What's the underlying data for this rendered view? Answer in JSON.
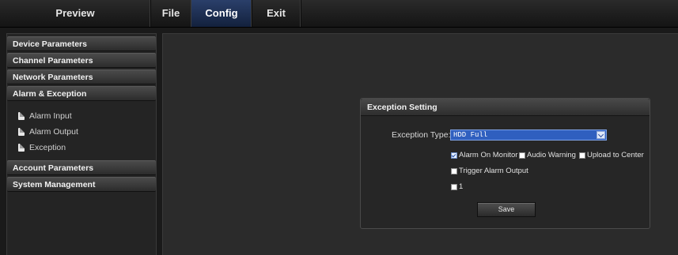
{
  "nav": {
    "preview": "Preview",
    "file": "File",
    "config": "Config",
    "exit": "Exit"
  },
  "sidebar": {
    "device_parameters": "Device Parameters",
    "channel_parameters": "Channel Parameters",
    "network_parameters": "Network Parameters",
    "alarm_exception": "Alarm & Exception",
    "alarm_input": "Alarm Input",
    "alarm_output": "Alarm Output",
    "exception": "Exception",
    "account_parameters": "Account Parameters",
    "system_management": "System Management"
  },
  "panel": {
    "title": "Exception Setting",
    "exception_type_label": "Exception Type:",
    "exception_type_value": "HDD Full",
    "alarm_on_monitor": "Alarm On Monitor",
    "audio_warning": "Audio Warning",
    "upload_to_center": "Upload to Center",
    "trigger_alarm_output": "Trigger Alarm Output",
    "output_1": "1",
    "save": "Save"
  },
  "state": {
    "alarm_on_monitor_checked": true,
    "audio_warning_checked": false,
    "upload_to_center_checked": false,
    "trigger_alarm_output_checked": false,
    "output_1_checked": false
  }
}
